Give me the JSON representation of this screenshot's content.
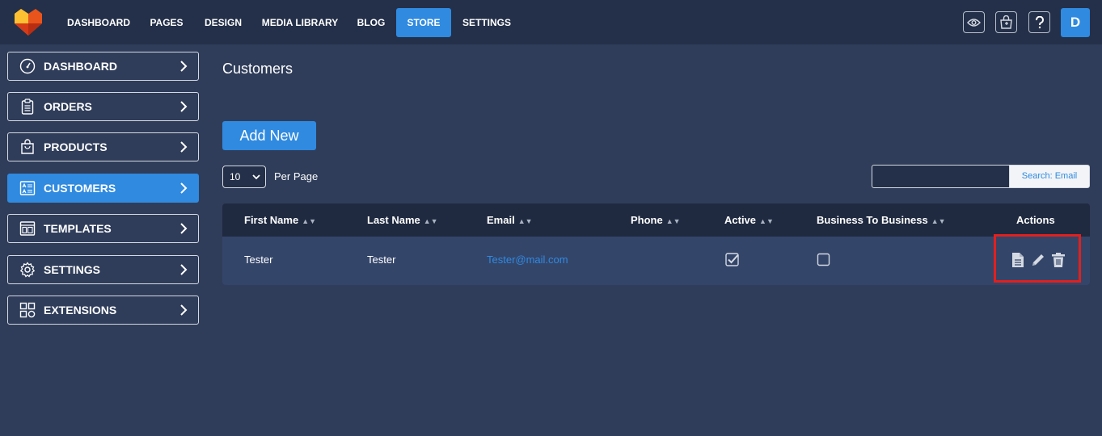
{
  "topnav": {
    "items": [
      "DASHBOARD",
      "PAGES",
      "DESIGN",
      "MEDIA LIBRARY",
      "BLOG",
      "STORE",
      "SETTINGS"
    ],
    "active": "STORE",
    "avatar_letter": "D",
    "icons": [
      "eye-icon",
      "store-basket-icon",
      "help-icon"
    ]
  },
  "sidebar": {
    "items": [
      {
        "label": "DASHBOARD",
        "icon": "gauge-icon"
      },
      {
        "label": "ORDERS",
        "icon": "clipboard-icon"
      },
      {
        "label": "PRODUCTS",
        "icon": "shopping-bag-icon"
      },
      {
        "label": "CUSTOMERS",
        "icon": "id-card-icon"
      },
      {
        "label": "TEMPLATES",
        "icon": "template-icon"
      },
      {
        "label": "SETTINGS",
        "icon": "gear-icon"
      },
      {
        "label": "EXTENSIONS",
        "icon": "extensions-icon"
      }
    ],
    "active": "CUSTOMERS"
  },
  "main": {
    "title": "Customers",
    "add_button": "Add New",
    "per_page_value": "10",
    "per_page_label": "Per Page",
    "search_button": "Search: Email",
    "search_value": ""
  },
  "table": {
    "columns": [
      "First Name",
      "Last Name",
      "Email",
      "Phone",
      "Active",
      "Business To Business",
      "Actions"
    ],
    "rows": [
      {
        "first_name": "Tester",
        "last_name": "Tester",
        "email": "Tester@mail.com",
        "phone": "",
        "active": true,
        "b2b": false
      }
    ]
  },
  "colors": {
    "accent": "#2f8ae0",
    "background": "#2f3d5a",
    "topbar": "#243049",
    "highlight": "#e0201e"
  }
}
